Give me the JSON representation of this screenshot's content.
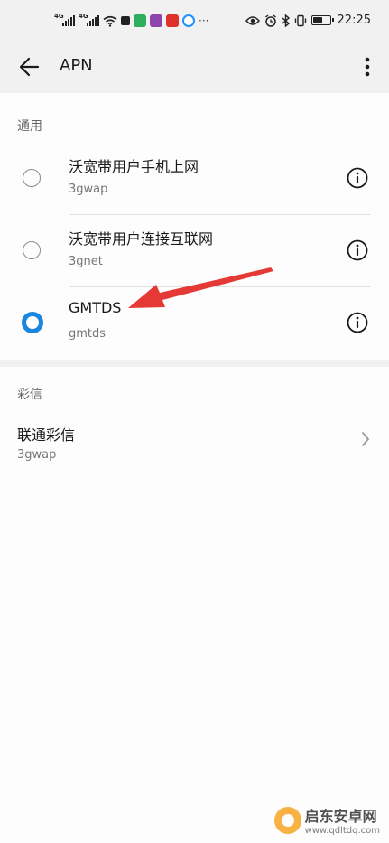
{
  "status_bar": {
    "network_1": "4G",
    "network_2": "4G",
    "time": "22:25",
    "battery_level": 0.5
  },
  "app_bar": {
    "title": "APN",
    "back_icon": "arrow-left-icon",
    "more_icon": "more-vert-icon"
  },
  "general": {
    "header": "通用",
    "items": [
      {
        "name": "沃宽带用户手机上网",
        "apn": "3gwap",
        "selected": false
      },
      {
        "name": "沃宽带用户连接互联网",
        "apn": "3gnet",
        "selected": false
      },
      {
        "name": "GMTDS",
        "apn": "gmtds",
        "selected": true
      }
    ]
  },
  "mms": {
    "header": "彩信",
    "item": {
      "name": "联通彩信",
      "apn": "3gwap"
    }
  },
  "annotation": {
    "arrow_color": "#e53935"
  },
  "watermark": {
    "text": "启东安卓网",
    "url": "www.qdltdq.com"
  },
  "colors": {
    "accent": "#1a86dd",
    "background": "#f1f1f1",
    "panel": "#fdfdfd"
  }
}
